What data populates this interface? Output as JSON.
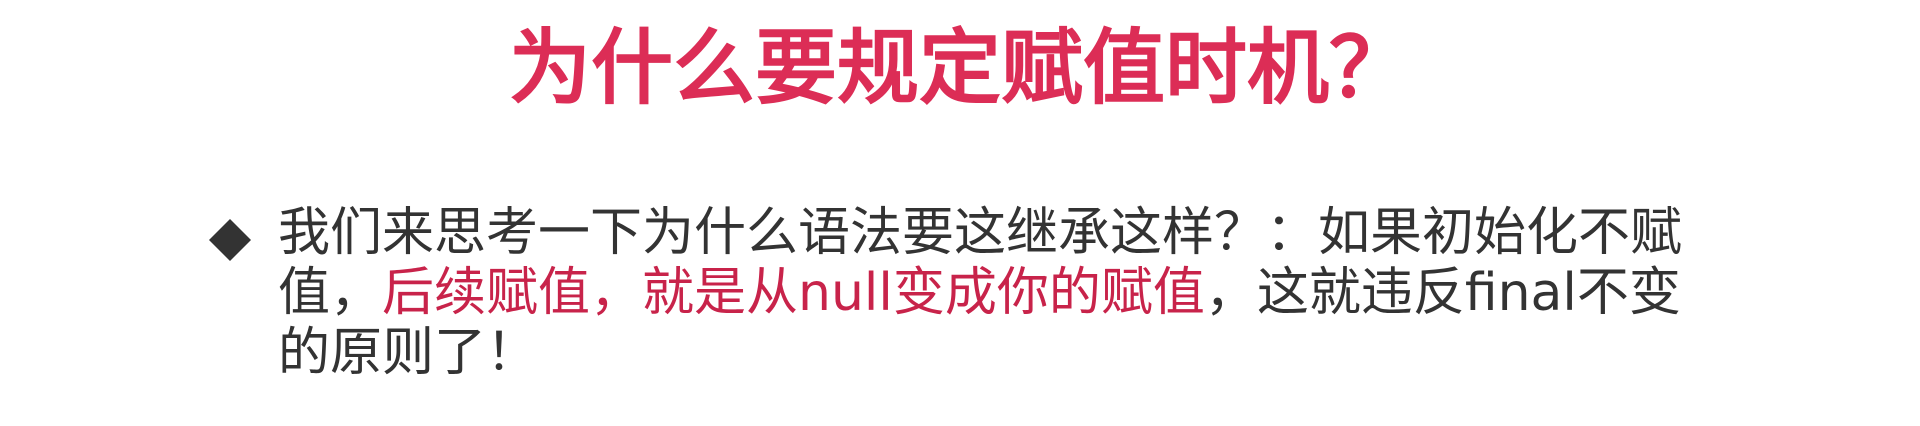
{
  "title": "为什么要规定赋值时机？",
  "colors": {
    "title": "#dc2d56",
    "body": "#333333",
    "highlight": "#c8234a",
    "bullet": "#333333"
  },
  "bullet": {
    "icon": "diamond-bullet-icon",
    "line1": "我们来思考一下为什么语法要这继承这样？：如果初始化不赋",
    "line2_start": "值，",
    "line2_highlight": "后续赋值，就是从null变成你的赋值",
    "line2_end": "，这就违反final不变",
    "line3": "的原则了！"
  }
}
